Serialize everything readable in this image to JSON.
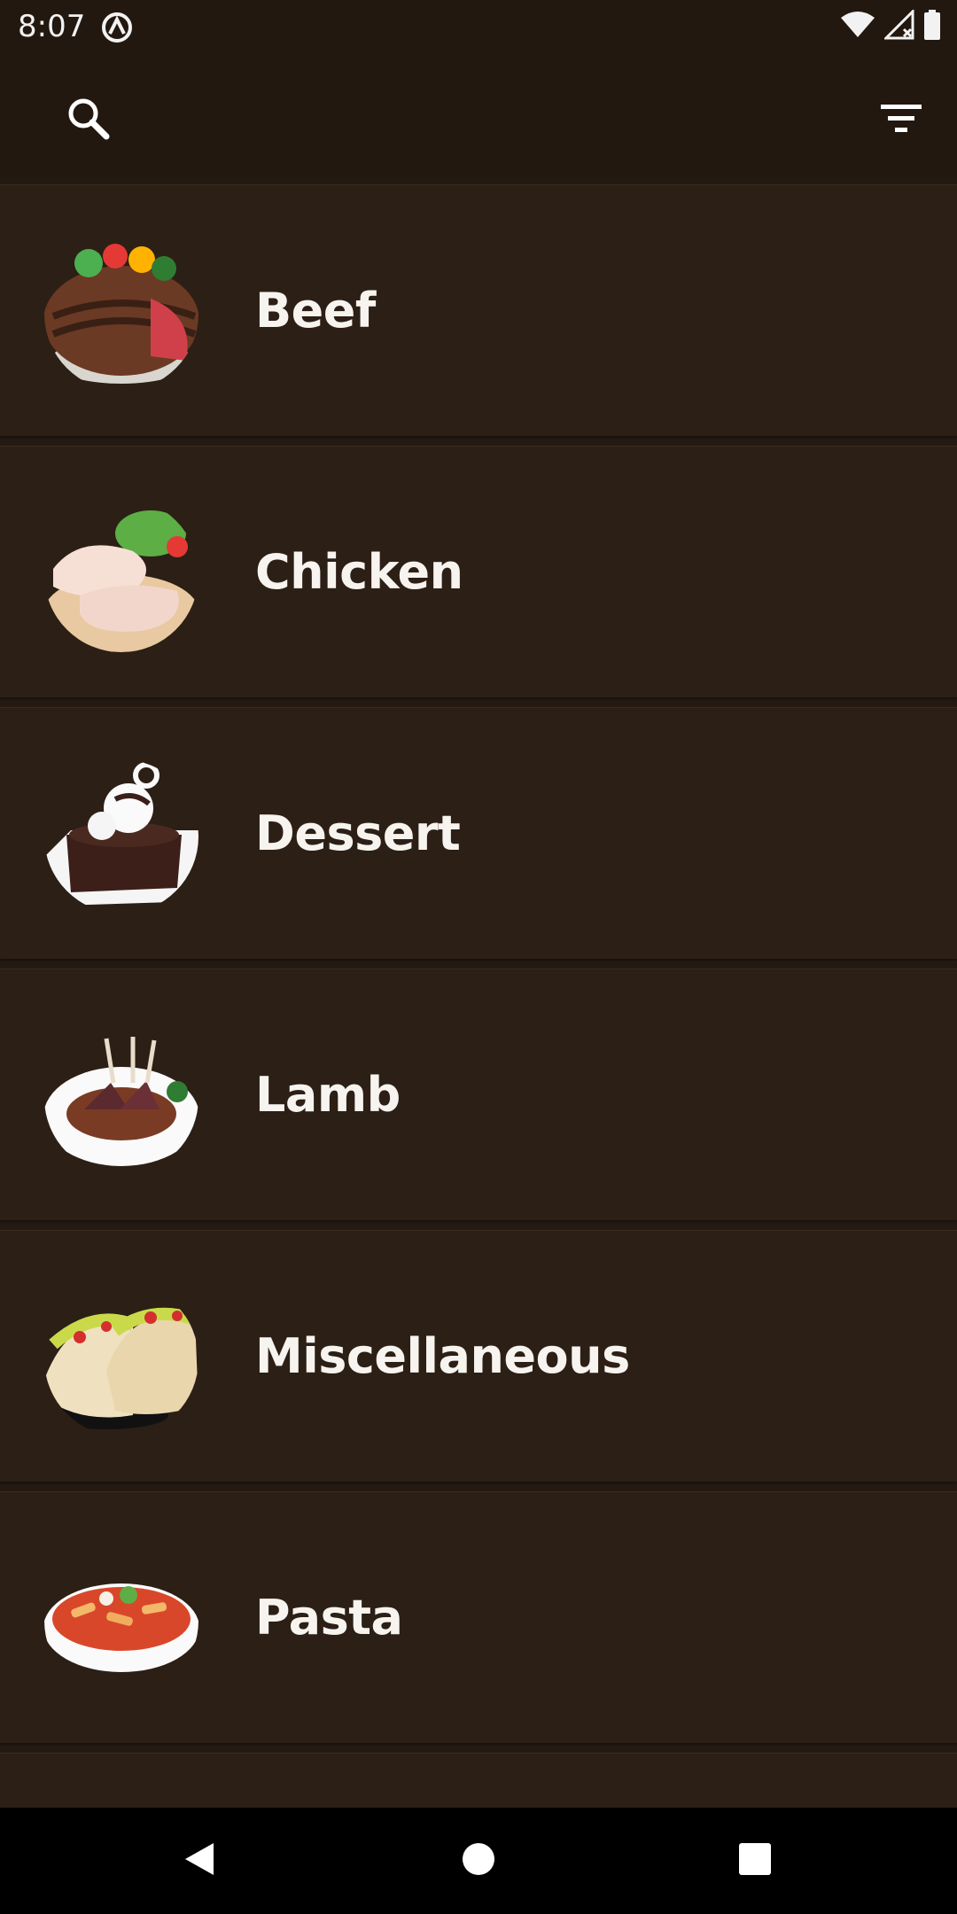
{
  "status_bar": {
    "time": "8:07",
    "app_icon": "activity-icon",
    "icons": [
      "wifi-icon",
      "signal-icon",
      "battery-icon"
    ]
  },
  "app_bar": {
    "search_icon": "search-icon",
    "filter_icon": "filter-icon"
  },
  "categories": [
    {
      "label": "Beef",
      "image": "beef-steak-image"
    },
    {
      "label": "Chicken",
      "image": "chicken-legs-image"
    },
    {
      "label": "Dessert",
      "image": "chocolate-cake-image"
    },
    {
      "label": "Lamb",
      "image": "lamb-chops-image"
    },
    {
      "label": "Miscellaneous",
      "image": "tacos-image"
    },
    {
      "label": "Pasta",
      "image": "pasta-dish-image"
    }
  ],
  "nav_bar": {
    "back_icon": "back-icon",
    "home_icon": "home-icon",
    "recents_icon": "recents-icon"
  },
  "colors": {
    "background": "#2c1f15",
    "app_bar": "#221810",
    "text": "#f7f4f0"
  }
}
